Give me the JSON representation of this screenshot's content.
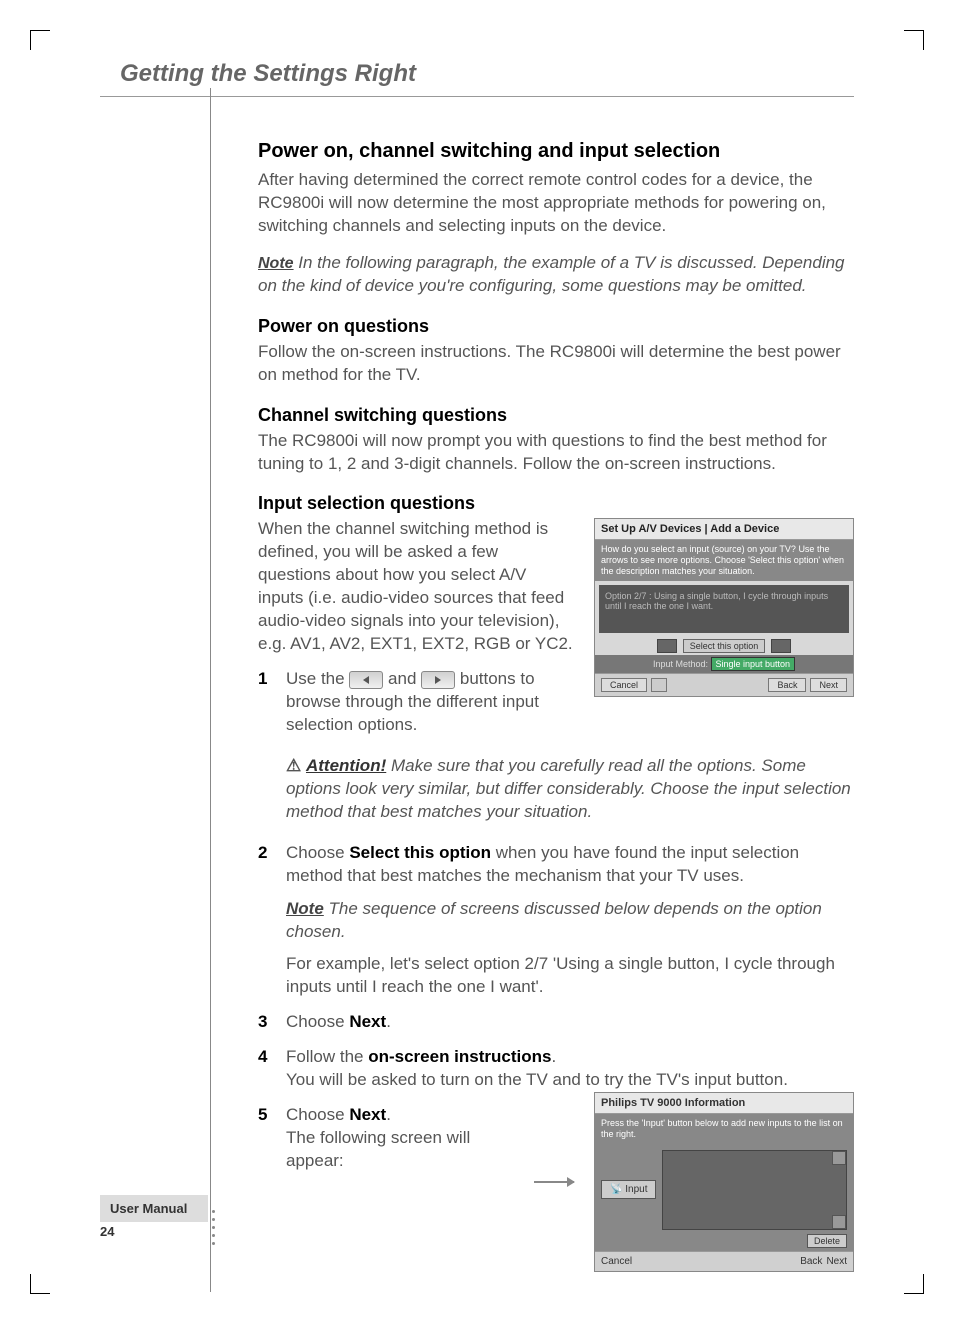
{
  "header": {
    "chapter_title": "Getting the Settings Right"
  },
  "sections": {
    "main_heading": "Power on, channel switching and input selection",
    "main_intro": "After having determined the correct remote control codes for a device, the RC9800i will now determine the most appropriate methods for powering on, switching channels and selecting inputs on the device.",
    "note1_label": "Note",
    "note1_text": " In the following paragraph, the example of a TV is discussed. Depending on the kind of device you're configuring, some questions may be omitted.",
    "poweron_h": "Power on questions",
    "poweron_body": "Follow the on-screen instructions. The RC9800i will determine the best power on method for the TV.",
    "channel_h": "Channel switching questions",
    "channel_body": "The RC9800i will now prompt you with questions to find the best method for tuning to 1, 2 and 3-digit channels. Follow the on-screen instructions.",
    "input_h": "Input selection questions",
    "input_body": "When the channel switching method is defined, you will be asked a few questions about how you select A/V inputs (i.e. audio-video sources that feed audio-video signals into your television), e.g. AV1, AV2, EXT1, EXT2, RGB or YC2.",
    "step1_num": "1",
    "step1_a": "Use the ",
    "step1_b": " and ",
    "step1_c": " buttons to browse through the different input selection options.",
    "attention_label": "Attention!",
    "attention_text": " Make sure that you carefully read all the options. Some options look very similar, but differ considerably. Choose the input selection method that best matches your situation.",
    "step2_num": "2",
    "step2_a": "Choose ",
    "step2_bold": "Select this option",
    "step2_b": " when you have found the input selection method that best matches the mechanism that your TV uses.",
    "note2_label": "Note",
    "note2_text": " The sequence of screens discussed below depends on the option chosen.",
    "step2_example": "For example, let's select option 2/7 'Using a single button, I cycle through inputs until I reach the one I want'.",
    "step3_num": "3",
    "step3_a": "Choose ",
    "step3_bold": "Next",
    "step3_b": ".",
    "step4_num": "4",
    "step4_a": "Follow the ",
    "step4_bold": "on-screen instructions",
    "step4_b": ".",
    "step4_body": "You will be asked to turn on the TV and to try the TV's input button.",
    "step5_num": "5",
    "step5_a": "Choose ",
    "step5_bold": "Next",
    "step5_b": ".",
    "step5_body": "The following screen will appear:"
  },
  "screenshot1": {
    "title": "Set Up A/V Devices | Add a Device",
    "instr": "How do you select an input (source) on your TV? Use the arrows to see more options. Choose 'Select this option' when the description matches your situation.",
    "panel_text": "Option 2/7 : Using a single button, I cycle through inputs until I reach the one I want.",
    "select_btn": "Select this option",
    "method_label": "Input Method:",
    "method_value": "Single input button",
    "cancel": "Cancel",
    "back": "Back",
    "next": "Next"
  },
  "screenshot2": {
    "title": "Philips TV 9000 Information",
    "instr": "Press the 'Input' button below to add new inputs to the list on the right.",
    "input_btn": "Input",
    "delete_btn": "Delete",
    "cancel": "Cancel",
    "back": "Back",
    "next": "Next"
  },
  "footer": {
    "label": "User Manual",
    "page": "24"
  }
}
